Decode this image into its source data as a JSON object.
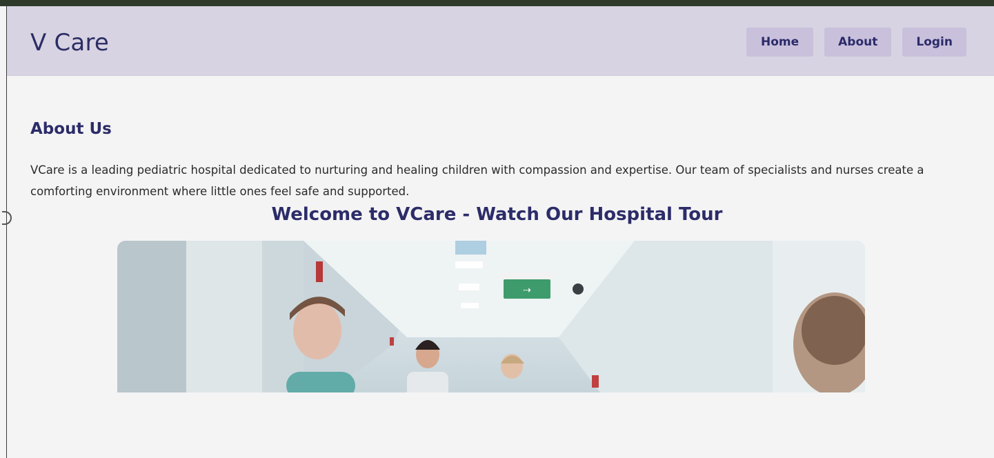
{
  "header": {
    "brand": "V Care",
    "nav": [
      {
        "label": "Home"
      },
      {
        "label": "About"
      },
      {
        "label": "Login"
      }
    ]
  },
  "about": {
    "title": "About Us",
    "text": "VCare is a leading pediatric hospital dedicated to nurturing and healing children with compassion and expertise. Our team of specialists and nurses create a comforting environment where little ones feel safe and supported."
  },
  "tour": {
    "title": "Welcome to VCare - Watch Our Hospital Tour"
  },
  "colors": {
    "header_bg": "#d8d3e2",
    "nav_button_bg": "#c9c0dc",
    "heading": "#2c2c69",
    "page_bg": "#f4f4f5"
  }
}
